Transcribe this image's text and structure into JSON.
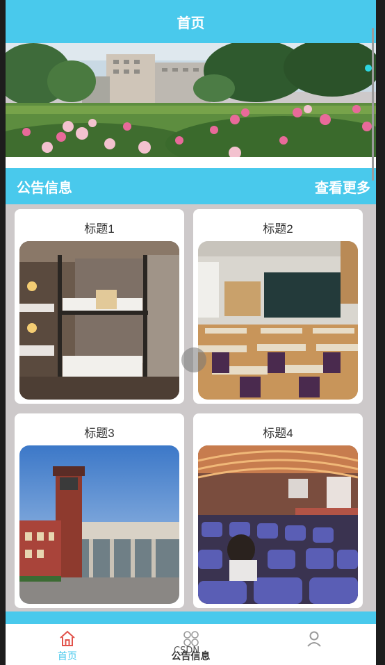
{
  "header": {
    "title": "首页"
  },
  "section": {
    "title": "公告信息",
    "more_label": "查看更多"
  },
  "cards": [
    {
      "title": "标题1",
      "image_icon": "dormitory-photo"
    },
    {
      "title": "标题2",
      "image_icon": "classroom-photo"
    },
    {
      "title": "标题3",
      "image_icon": "building-photo"
    },
    {
      "title": "标题4",
      "image_icon": "lecture-hall-photo"
    }
  ],
  "tabbar": {
    "items": [
      {
        "label": "首页",
        "icon": "home-icon",
        "active": true
      },
      {
        "label": "公告信息",
        "icon": "grid-icon",
        "active": false
      },
      {
        "label": "",
        "icon": "user-icon",
        "active": false
      }
    ]
  },
  "watermark": {
    "text": "CSDN"
  },
  "colors": {
    "accent": "#49c9ec",
    "background": "#cdc9ca",
    "card": "#ffffff"
  }
}
